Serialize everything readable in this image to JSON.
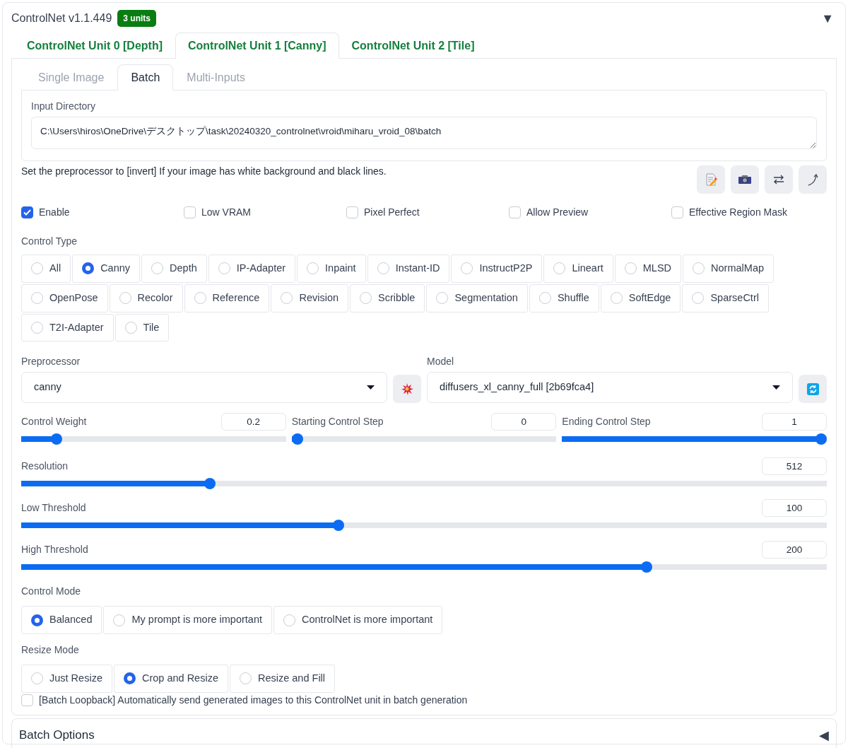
{
  "header": {
    "title": "ControlNet v1.1.449",
    "badge": "3 units",
    "toggle": "▼"
  },
  "unit_tabs": [
    {
      "label": "ControlNet Unit 0 [Depth]",
      "selected": false
    },
    {
      "label": "ControlNet Unit 1 [Canny]",
      "selected": true
    },
    {
      "label": "ControlNet Unit 2 [Tile]",
      "selected": false
    }
  ],
  "input_tabs": [
    {
      "label": "Single Image",
      "selected": false
    },
    {
      "label": "Batch",
      "selected": true
    },
    {
      "label": "Multi-Inputs",
      "selected": false
    }
  ],
  "input_directory": {
    "label": "Input Directory",
    "value": "C:\\Users\\hiros\\OneDrive\\デスクトップ\\task\\20240320_controlnet\\vroid\\miharu_vroid_08\\batch"
  },
  "hint": "Set the preprocessor to [invert] If your image has white background and black lines.",
  "options": [
    {
      "label": "Enable",
      "checked": true
    },
    {
      "label": "Low VRAM",
      "checked": false
    },
    {
      "label": "Pixel Perfect",
      "checked": false
    },
    {
      "label": "Allow Preview",
      "checked": false
    },
    {
      "label": "Effective Region Mask",
      "checked": false
    }
  ],
  "control_type": {
    "label": "Control Type",
    "options": [
      {
        "label": "All",
        "selected": false
      },
      {
        "label": "Canny",
        "selected": true
      },
      {
        "label": "Depth",
        "selected": false
      },
      {
        "label": "IP-Adapter",
        "selected": false
      },
      {
        "label": "Inpaint",
        "selected": false
      },
      {
        "label": "Instant-ID",
        "selected": false
      },
      {
        "label": "InstructP2P",
        "selected": false
      },
      {
        "label": "Lineart",
        "selected": false
      },
      {
        "label": "MLSD",
        "selected": false
      },
      {
        "label": "NormalMap",
        "selected": false
      },
      {
        "label": "OpenPose",
        "selected": false
      },
      {
        "label": "Recolor",
        "selected": false
      },
      {
        "label": "Reference",
        "selected": false
      },
      {
        "label": "Revision",
        "selected": false
      },
      {
        "label": "Scribble",
        "selected": false
      },
      {
        "label": "Segmentation",
        "selected": false
      },
      {
        "label": "Shuffle",
        "selected": false
      },
      {
        "label": "SoftEdge",
        "selected": false
      },
      {
        "label": "SparseCtrl",
        "selected": false
      },
      {
        "label": "T2I-Adapter",
        "selected": false
      },
      {
        "label": "Tile",
        "selected": false
      }
    ]
  },
  "preprocessor": {
    "label": "Preprocessor",
    "value": "canny"
  },
  "model": {
    "label": "Model",
    "value": "diffusers_xl_canny_full [2b69fca4]"
  },
  "step_sliders": [
    {
      "label": "Control Weight",
      "value": "0.2",
      "level": 0.117
    },
    {
      "label": "Starting Control Step",
      "value": "0",
      "level": 0
    },
    {
      "label": "Ending Control Step",
      "value": "1",
      "level": 1
    }
  ],
  "sliders": [
    {
      "label": "Resolution",
      "value": "512",
      "level": 0.23
    },
    {
      "label": "Low Threshold",
      "value": "100",
      "level": 0.392
    },
    {
      "label": "High Threshold",
      "value": "200",
      "level": 0.78
    }
  ],
  "control_mode": {
    "label": "Control Mode",
    "options": [
      {
        "label": "Balanced",
        "selected": true
      },
      {
        "label": "My prompt is more important",
        "selected": false
      },
      {
        "label": "ControlNet is more important",
        "selected": false
      }
    ]
  },
  "resize_mode": {
    "label": "Resize Mode",
    "options": [
      {
        "label": "Just Resize",
        "selected": false
      },
      {
        "label": "Crop and Resize",
        "selected": true
      },
      {
        "label": "Resize and Fill",
        "selected": false
      }
    ]
  },
  "batch_loopback": {
    "label": "[Batch Loopback] Automatically send generated images to this ControlNet unit in batch generation",
    "checked": false
  },
  "batch_options": {
    "title": "Batch Options",
    "toggle": "◀"
  }
}
